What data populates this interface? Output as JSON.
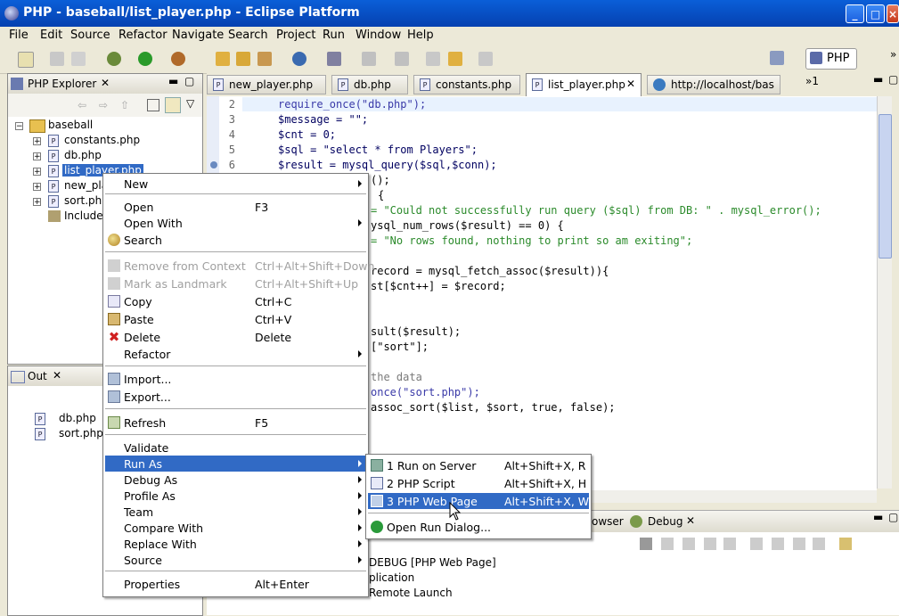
{
  "window": {
    "title": "PHP - baseball/list_player.php - Eclipse Platform"
  },
  "menubar": [
    "File",
    "Edit",
    "Source",
    "Refactor",
    "Navigate",
    "Search",
    "Project",
    "Run",
    "Window",
    "Help"
  ],
  "perspective": {
    "label": "PHP"
  },
  "explorer": {
    "title": "PHP Explorer",
    "project": "baseball",
    "items": [
      "constants.php",
      "db.php",
      "list_player.php",
      "new_pla",
      "sort.php",
      "Include"
    ]
  },
  "outline": {
    "title": "Out",
    "items": [
      "db.php",
      "sort.php"
    ]
  },
  "editor_tabs": [
    "new_player.php",
    "db.php",
    "constants.php",
    "list_player.php",
    "http://localhost/bas"
  ],
  "editor_tab_overflow": "»1",
  "code": {
    "linenos": [
      "2",
      "3",
      "4",
      "5",
      "6"
    ],
    "lines": [
      "require_once(\"db.php\");",
      "$message = \"\";",
      "$cnt = 0;",
      "$sql = \"select * from Players\";",
      "$result = mysql_query($sql,$conn);",
      "();",
      "{",
      "= \"Could not successfully run query ($sql) from DB: \" . mysql_error();",
      "ysql_num_rows($result) == 0) {",
      "= \"No rows found, nothing to print so am exiting\";",
      "record = mysql_fetch_assoc($result)){",
      "st[$cnt++] = $record;",
      "sult($result);",
      "[\"sort\"];",
      "the data",
      "once(\"sort.php\");",
      "assoc_sort($list, $sort, true, false);"
    ]
  },
  "bottom_panel": {
    "tabs": [
      "owser",
      "Debug"
    ],
    "lines": [
      "DEBUG [PHP Web Page]",
      "plication",
      "Remote Launch"
    ]
  },
  "context_menu": {
    "items": [
      {
        "label": "New",
        "acc": "",
        "submenu": true,
        "disabled": false
      },
      {
        "label": "Open",
        "acc": "F3",
        "submenu": false,
        "disabled": false
      },
      {
        "label": "Open With",
        "acc": "",
        "submenu": true,
        "disabled": false
      },
      {
        "label": "Search",
        "acc": "",
        "submenu": false,
        "disabled": false
      },
      {
        "label": "Remove from Context",
        "acc": "Ctrl+Alt+Shift+Down",
        "submenu": false,
        "disabled": true
      },
      {
        "label": "Mark as Landmark",
        "acc": "Ctrl+Alt+Shift+Up",
        "submenu": false,
        "disabled": true
      },
      {
        "label": "Copy",
        "acc": "Ctrl+C",
        "submenu": false,
        "disabled": false
      },
      {
        "label": "Paste",
        "acc": "Ctrl+V",
        "submenu": false,
        "disabled": false
      },
      {
        "label": "Delete",
        "acc": "Delete",
        "submenu": false,
        "disabled": false
      },
      {
        "label": "Refactor",
        "acc": "",
        "submenu": true,
        "disabled": false
      },
      {
        "label": "Import...",
        "acc": "",
        "submenu": false,
        "disabled": false
      },
      {
        "label": "Export...",
        "acc": "",
        "submenu": false,
        "disabled": false
      },
      {
        "label": "Refresh",
        "acc": "F5",
        "submenu": false,
        "disabled": false
      },
      {
        "label": "Validate",
        "acc": "",
        "submenu": false,
        "disabled": false
      },
      {
        "label": "Run As",
        "acc": "",
        "submenu": true,
        "disabled": false,
        "selected": true
      },
      {
        "label": "Debug As",
        "acc": "",
        "submenu": true,
        "disabled": false
      },
      {
        "label": "Profile As",
        "acc": "",
        "submenu": true,
        "disabled": false
      },
      {
        "label": "Team",
        "acc": "",
        "submenu": true,
        "disabled": false
      },
      {
        "label": "Compare With",
        "acc": "",
        "submenu": true,
        "disabled": false
      },
      {
        "label": "Replace With",
        "acc": "",
        "submenu": true,
        "disabled": false
      },
      {
        "label": "Source",
        "acc": "",
        "submenu": true,
        "disabled": false
      },
      {
        "label": "Properties",
        "acc": "Alt+Enter",
        "submenu": false,
        "disabled": false
      }
    ]
  },
  "run_as_menu": {
    "items": [
      {
        "label": "1 Run on Server",
        "acc": "Alt+Shift+X, R"
      },
      {
        "label": "2 PHP Script",
        "acc": "Alt+Shift+X, H"
      },
      {
        "label": "3 PHP Web Page",
        "acc": "Alt+Shift+X, W",
        "selected": true
      },
      {
        "label": "Open Run Dialog...",
        "acc": ""
      }
    ]
  },
  "colors": {
    "selection": "#316ac5",
    "titlebar": "#0853c8",
    "string": "#2a8a2a",
    "keyword": "#3a3aa8"
  }
}
